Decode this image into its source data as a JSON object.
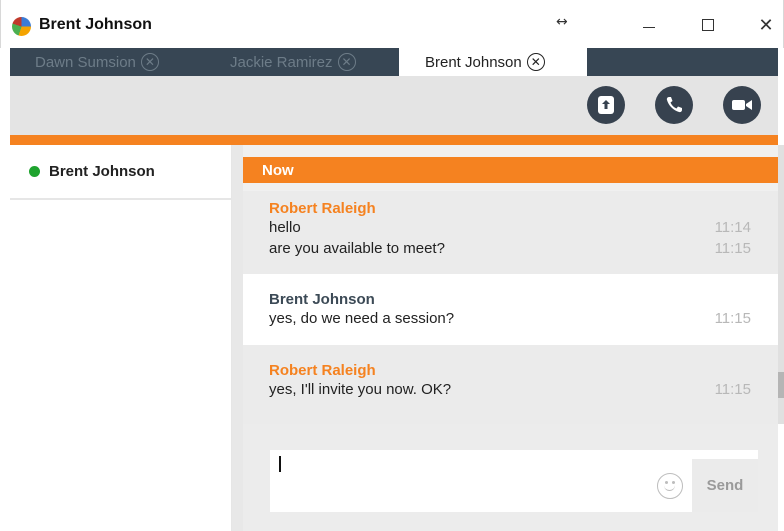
{
  "window": {
    "title": "Brent Johnson",
    "resize_glyph": "↔",
    "close_glyph": "✕"
  },
  "tabs": [
    {
      "label": "Dawn Sumsion",
      "active": false
    },
    {
      "label": "Jackie Ramirez",
      "active": false
    },
    {
      "label": "Brent Johnson",
      "active": true
    }
  ],
  "tab_close_glyph": "✕",
  "toolbar": {
    "icons": [
      "share-screen-icon",
      "phone-icon",
      "video-camera-icon"
    ]
  },
  "contacts": [
    {
      "name": "Brent Johnson",
      "status": "online"
    }
  ],
  "chat": {
    "section_label": "Now",
    "messages": [
      {
        "sender": "Robert Raleigh",
        "lines": [
          {
            "text": "hello",
            "time": "11:14"
          },
          {
            "text": "are you available to meet?",
            "time": "11:15"
          }
        ]
      },
      {
        "sender": "Brent Johnson",
        "lines": [
          {
            "text": "yes, do we need a session?",
            "time": "11:15"
          }
        ]
      },
      {
        "sender": "Robert Raleigh",
        "lines": [
          {
            "text": "yes, I'll invite you now. OK?",
            "time": "11:15"
          }
        ]
      }
    ]
  },
  "composer": {
    "value": "",
    "send_label": "Send",
    "emoji_icon": "smiley-icon"
  },
  "colors": {
    "accent": "#f58220",
    "tab_bar": "#374654",
    "online": "#1ea32e",
    "sender_self": "#3c4a56"
  }
}
